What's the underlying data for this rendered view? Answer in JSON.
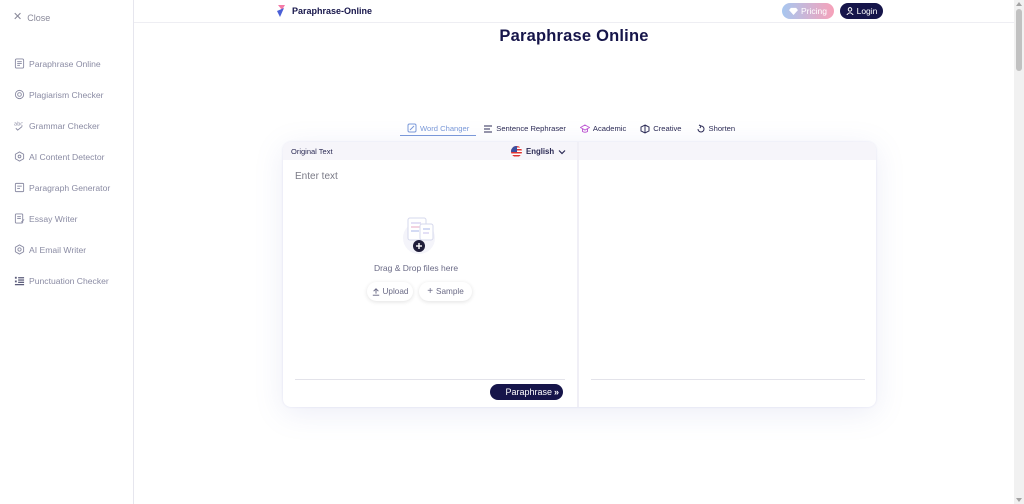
{
  "sidebar": {
    "close_label": "Close",
    "items": [
      {
        "label": "Paraphrase Online",
        "icon": "document-icon"
      },
      {
        "label": "Plagiarism Checker",
        "icon": "plagiarism-icon"
      },
      {
        "label": "Grammar Checker",
        "icon": "abc-check-icon"
      },
      {
        "label": "AI Content Detector",
        "icon": "hexagon-detector-icon"
      },
      {
        "label": "Paragraph Generator",
        "icon": "paragraph-icon"
      },
      {
        "label": "Essay Writer",
        "icon": "pen-document-icon"
      },
      {
        "label": "AI Email Writer",
        "icon": "hexagon-email-icon"
      },
      {
        "label": "Punctuation Checker",
        "icon": "punctuation-icon"
      }
    ]
  },
  "header": {
    "brand": "Paraphrase-Online",
    "pricing_label": "Pricing",
    "login_label": "Login"
  },
  "page_title": "Paraphrase Online",
  "tabs": [
    {
      "label": "Word Changer",
      "active": true,
      "icon": "word-changer-icon"
    },
    {
      "label": "Sentence Rephraser",
      "active": false,
      "icon": "sentence-icon"
    },
    {
      "label": "Academic",
      "active": false,
      "icon": "academic-icon"
    },
    {
      "label": "Creative",
      "active": false,
      "icon": "creative-icon"
    },
    {
      "label": "Shorten",
      "active": false,
      "icon": "shorten-icon"
    }
  ],
  "editor": {
    "original_label": "Original Text",
    "language": "English",
    "input_placeholder": "Enter text",
    "input_value": "",
    "drop_text": "Drag & Drop files here",
    "upload_label": "Upload",
    "sample_label": "Sample",
    "paraphrase_label": "Paraphrase"
  },
  "colors": {
    "brand_dark": "#16154a",
    "accent_blue": "#7b9ad9",
    "pricing_gradient_start": "#a7c7f0",
    "pricing_gradient_end": "#f7a1b9"
  }
}
